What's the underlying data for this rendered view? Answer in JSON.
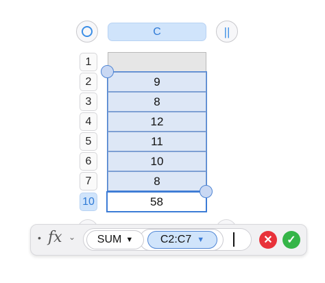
{
  "column_header": {
    "label": "C"
  },
  "icons": {
    "select_all": "circle-icon",
    "column_controls": "pause-bars-icon",
    "bars_glyph": "||"
  },
  "rows": [
    {
      "num": "1",
      "value": ""
    },
    {
      "num": "2",
      "value": "9"
    },
    {
      "num": "3",
      "value": "8"
    },
    {
      "num": "4",
      "value": "12"
    },
    {
      "num": "5",
      "value": "11"
    },
    {
      "num": "6",
      "value": "10"
    },
    {
      "num": "7",
      "value": "8"
    }
  ],
  "result_row": {
    "num": "10",
    "value": "58"
  },
  "formula_bar": {
    "bullet": "•",
    "fx_label": "fx",
    "fx_caret": "⌄",
    "function_name": "SUM",
    "dropdown_glyph": "▼",
    "range": "C2:C7",
    "cancel_glyph": "✕",
    "accept_glyph": "✓"
  },
  "colors": {
    "accent": "#3b7bd6",
    "selection_fill": "#dde7f6",
    "cancel": "#e8323a",
    "accept": "#35b548"
  }
}
